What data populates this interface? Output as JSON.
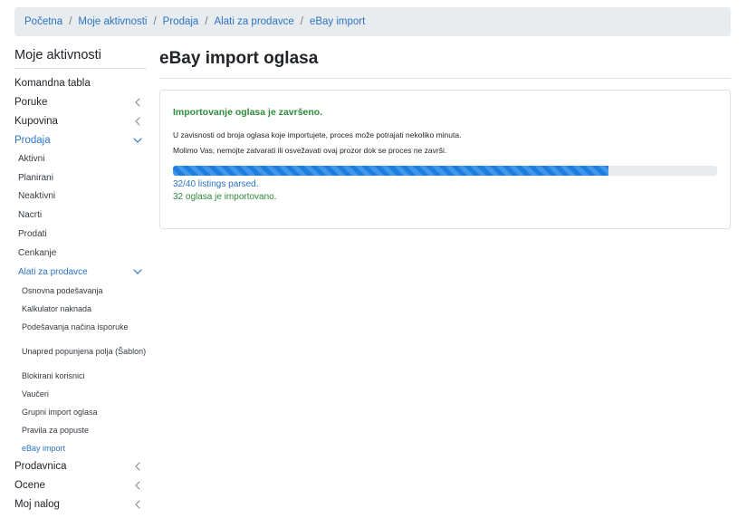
{
  "breadcrumb": [
    "Početna",
    "Moje aktivnosti",
    "Prodaja",
    "Alati za prodavce",
    "eBay import"
  ],
  "breadcrumb_separator": "/",
  "sidebar": {
    "title": "Moje aktivnosti",
    "items": [
      {
        "label": "Komandna tabla",
        "level": 1,
        "chevron": "none"
      },
      {
        "label": "Poruke",
        "level": 1,
        "chevron": "chevron-left-icon"
      },
      {
        "label": "Kupovina",
        "level": 1,
        "chevron": "chevron-left-icon"
      },
      {
        "label": "Prodaja",
        "level": 1,
        "chevron": "chevron-down-icon",
        "active": true
      },
      {
        "label": "Aktivni",
        "level": 2,
        "chevron": "none"
      },
      {
        "label": "Planirani",
        "level": 2,
        "chevron": "none"
      },
      {
        "label": "Neaktivni",
        "level": 2,
        "chevron": "none"
      },
      {
        "label": "Nacrti",
        "level": 2,
        "chevron": "none"
      },
      {
        "label": "Prodati",
        "level": 2,
        "chevron": "none"
      },
      {
        "label": "Cenkanje",
        "level": 2,
        "chevron": "none"
      },
      {
        "label": "Alati za prodavce",
        "level": 2,
        "chevron": "chevron-down-icon",
        "active": true
      },
      {
        "label": "Osnovna podešavanja",
        "level": 3,
        "chevron": "none"
      },
      {
        "label": "Kalkulator naknada",
        "level": 3,
        "chevron": "none"
      },
      {
        "label": "Podešavanja načina isporuke",
        "level": 3,
        "chevron": "none"
      },
      {
        "label": "Unapred popunjena polja (Šablon)",
        "level": 3,
        "chevron": "none",
        "twoline": true
      },
      {
        "label": "Blokirani korisnici",
        "level": 3,
        "chevron": "none"
      },
      {
        "label": "Vaučeri",
        "level": 3,
        "chevron": "none"
      },
      {
        "label": "Grupni import oglasa",
        "level": 3,
        "chevron": "none"
      },
      {
        "label": "Pravila za popuste",
        "level": 3,
        "chevron": "none"
      },
      {
        "label": "eBay import",
        "level": 3,
        "chevron": "none",
        "active": true
      },
      {
        "label": "Prodavnica",
        "level": 1,
        "chevron": "chevron-left-icon"
      },
      {
        "label": "Ocene",
        "level": 1,
        "chevron": "chevron-left-icon"
      },
      {
        "label": "Moj nalog",
        "level": 1,
        "chevron": "chevron-left-icon"
      }
    ]
  },
  "main": {
    "title": "eBay import oglasa",
    "status_title": "Importovanje oglasa je završeno.",
    "info_lines": [
      "U zavisnosti od broja oglasa koje importujete, proces može potrajati nekoliko minuta.",
      "Molimo Vas, nemojte zatvarati ili osvežavati ovaj prozor dok se proces ne završi."
    ],
    "progress_fraction": 0.8,
    "parsed_text": "32/40 listings parsed.",
    "imported_text": "32 oglasa je importovano."
  },
  "colors": {
    "accent": "#2a74c4",
    "success": "#2e8b3a",
    "progress_bar": "#1a7fe0",
    "progress_track": "#e9ecef",
    "breadcrumb_bg": "#e9ecef"
  }
}
